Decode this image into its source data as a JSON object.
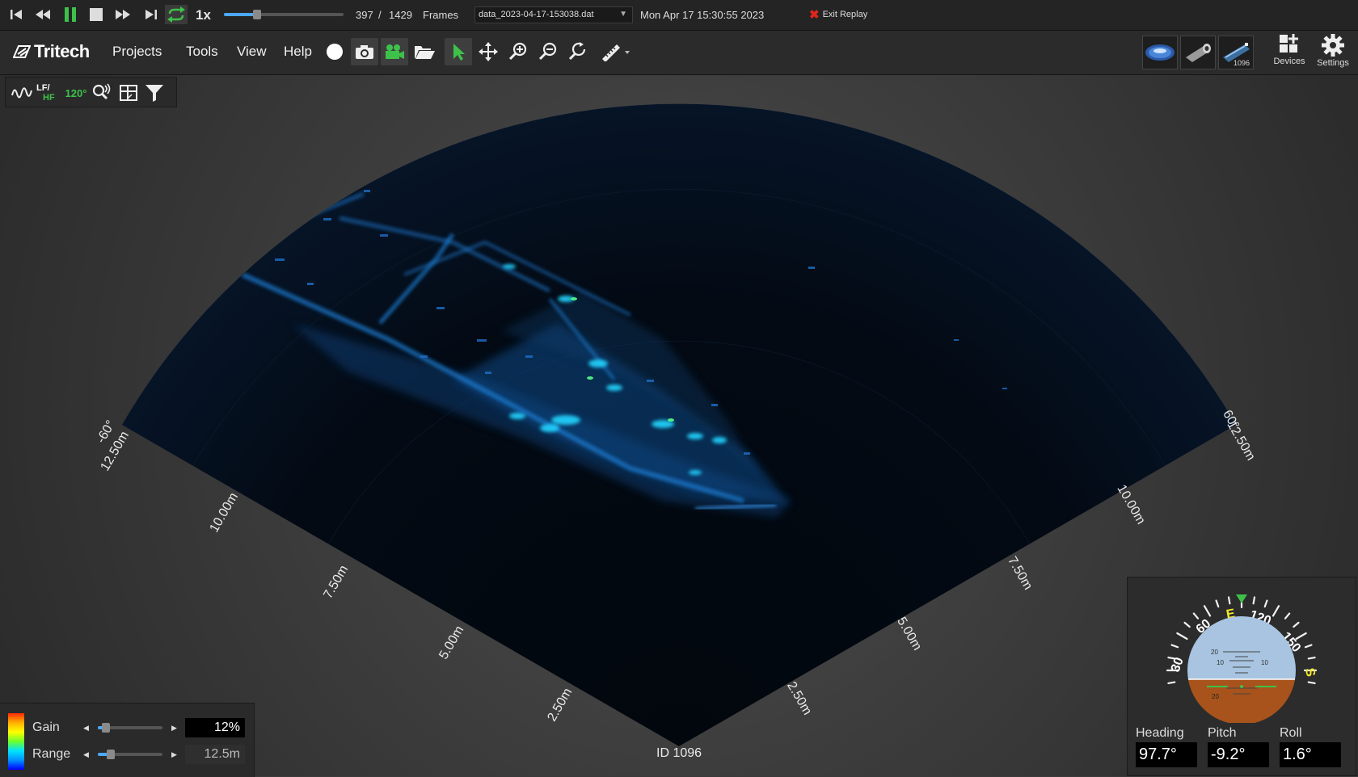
{
  "replay": {
    "speed": "1x",
    "progress": 0.277,
    "frame_current": "397",
    "frame_separator": "/",
    "frame_total": "1429",
    "frames_label": "Frames",
    "file_name": "data_2023-04-17-153038.dat",
    "datetime": "Mon Apr 17 15:30:55 2023",
    "exit_label": "Exit Replay",
    "controls": [
      "skip-to-start",
      "rewind",
      "pause",
      "stop",
      "fast-forward",
      "skip-to-end",
      "loop"
    ]
  },
  "toolbar": {
    "logo_text": "Tritech",
    "menu": [
      "Projects",
      "Tools",
      "View",
      "Help"
    ],
    "tools": [
      "record",
      "snapshot",
      "video-record",
      "open-folder",
      "select",
      "pan",
      "zoom-in",
      "zoom-out",
      "reset-view",
      "measure"
    ],
    "device_thumbs": [
      {
        "icon": "sonar-disc-device"
      },
      {
        "icon": "camera-device"
      },
      {
        "icon": "gemini-sonar-device",
        "id": "1096"
      }
    ],
    "devices_label": "Devices",
    "settings_label": "Settings"
  },
  "sonar_toolbar": {
    "lf_hf_top": "LF/",
    "lf_hf_bottom": "HF",
    "aperture": "120°"
  },
  "sonar": {
    "device_id": "ID 1096",
    "left_angle": "-60°",
    "right_angle": "60°",
    "left_ranges": [
      "2.50m",
      "5.00m",
      "7.50m",
      "10.00m",
      "12.50m"
    ],
    "right_ranges": [
      "2.50m",
      "5.00m",
      "7.50m",
      "10.00m",
      "12.50m"
    ]
  },
  "gain_panel": {
    "gain_label": "Gain",
    "gain_value": "12%",
    "gain_level": 0.12,
    "range_label": "Range",
    "range_value": "12.5m",
    "range_level": 0.2
  },
  "attitude": {
    "compass_labels": [
      "30",
      "60",
      "E",
      "120",
      "150",
      "S"
    ],
    "heading_label": "Heading",
    "heading_value": "97.7°",
    "pitch_label": "Pitch",
    "pitch_value": "-9.2°",
    "roll_label": "Roll",
    "roll_value": "1.6°",
    "pitch_ticks": [
      "20",
      "10",
      "10",
      "20"
    ]
  },
  "colors": {
    "accent_green": "#3ec14a",
    "accent_blue": "#4aa8ff",
    "exit_red": "#e0251b"
  }
}
